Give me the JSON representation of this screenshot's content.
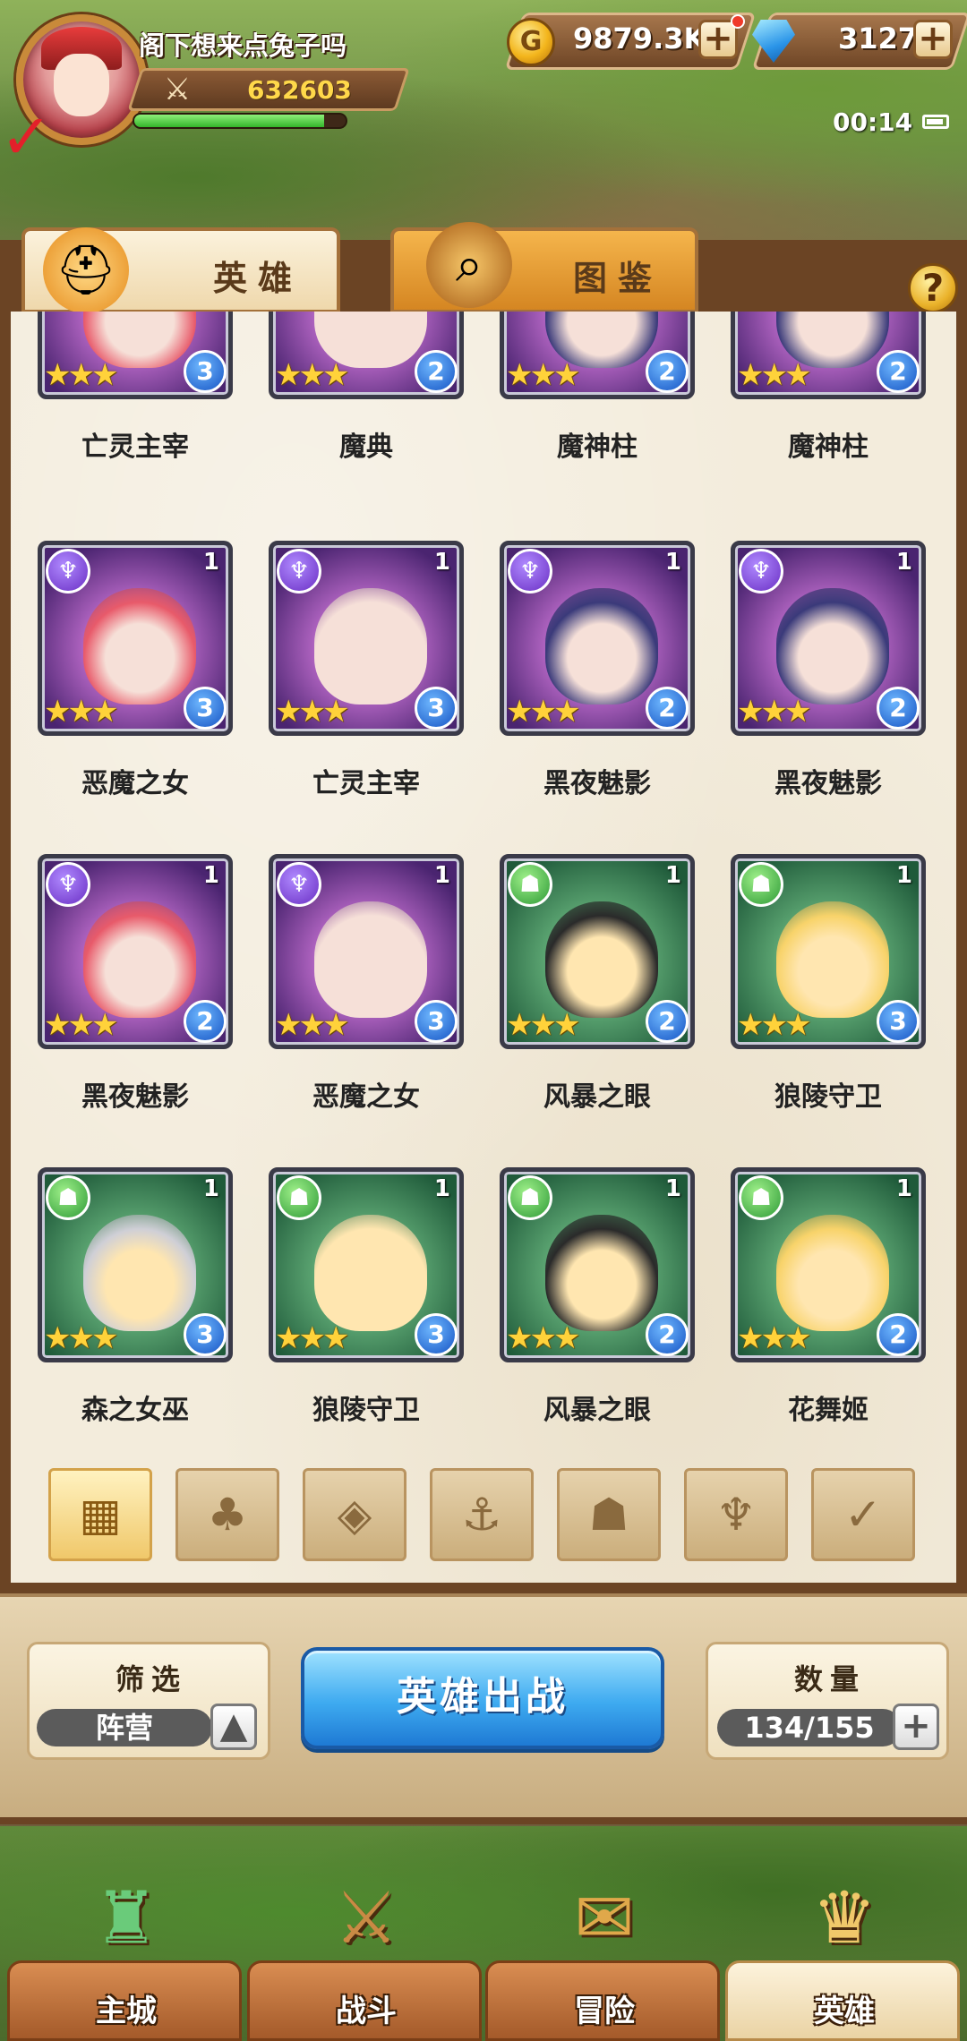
{
  "player": {
    "name": "阁下想来点兔子吗",
    "power": "632603",
    "exp_fraction": 0.9
  },
  "currency": {
    "gold": "9879.3K",
    "gems": "3127"
  },
  "status": {
    "time": "00:14"
  },
  "tabs": [
    {
      "label": "英雄",
      "icon": "knight-helmet-icon"
    },
    {
      "label": "图鉴",
      "icon": "magnifier-book-icon"
    }
  ],
  "help_label": "?",
  "heroes": [
    {
      "name": "亡灵主宰",
      "faction": "dark",
      "level": "",
      "grade": "3",
      "stars": 3,
      "theme": "purple"
    },
    {
      "name": "魔典",
      "faction": "dark",
      "level": "",
      "grade": "2",
      "stars": 3,
      "theme": "purple"
    },
    {
      "name": "魔神柱",
      "faction": "dark",
      "level": "",
      "grade": "2",
      "stars": 3,
      "theme": "purple"
    },
    {
      "name": "魔神柱",
      "faction": "dark",
      "level": "",
      "grade": "2",
      "stars": 3,
      "theme": "purple"
    },
    {
      "name": "恶魔之女",
      "faction": "dark",
      "level": "1",
      "grade": "3",
      "stars": 3,
      "theme": "purple"
    },
    {
      "name": "亡灵主宰",
      "faction": "dark",
      "level": "1",
      "grade": "3",
      "stars": 3,
      "theme": "purple"
    },
    {
      "name": "黑夜魅影",
      "faction": "dark",
      "level": "1",
      "grade": "2",
      "stars": 3,
      "theme": "purple"
    },
    {
      "name": "黑夜魅影",
      "faction": "dark",
      "level": "1",
      "grade": "2",
      "stars": 3,
      "theme": "purple"
    },
    {
      "name": "黑夜魅影",
      "faction": "dark",
      "level": "1",
      "grade": "2",
      "stars": 3,
      "theme": "purple"
    },
    {
      "name": "恶魔之女",
      "faction": "dark",
      "level": "1",
      "grade": "3",
      "stars": 3,
      "theme": "purple"
    },
    {
      "name": "风暴之眼",
      "faction": "nature",
      "level": "1",
      "grade": "2",
      "stars": 3,
      "theme": "green"
    },
    {
      "name": "狼陵守卫",
      "faction": "nature",
      "level": "1",
      "grade": "3",
      "stars": 3,
      "theme": "green"
    },
    {
      "name": "森之女巫",
      "faction": "nature",
      "level": "1",
      "grade": "3",
      "stars": 3,
      "theme": "green"
    },
    {
      "name": "狼陵守卫",
      "faction": "nature",
      "level": "1",
      "grade": "3",
      "stars": 3,
      "theme": "green"
    },
    {
      "name": "风暴之眼",
      "faction": "nature",
      "level": "1",
      "grade": "2",
      "stars": 3,
      "theme": "green"
    },
    {
      "name": "花舞姬",
      "faction": "nature",
      "level": "1",
      "grade": "2",
      "stars": 3,
      "theme": "green"
    }
  ],
  "faction_filters": [
    {
      "name": "all-grid-icon",
      "glyph": "▦",
      "active": true
    },
    {
      "name": "light-leaf-icon",
      "glyph": "♣",
      "active": false
    },
    {
      "name": "diamond-icon",
      "glyph": "◈",
      "active": false
    },
    {
      "name": "anchor-icon",
      "glyph": "⚓",
      "active": false
    },
    {
      "name": "beast-head-icon",
      "glyph": "☗",
      "active": false
    },
    {
      "name": "demon-horns-icon",
      "glyph": "♆",
      "active": false
    },
    {
      "name": "wings-icon",
      "glyph": "✓",
      "active": false
    }
  ],
  "controls": {
    "filter_title": "筛选",
    "filter_value": "阵营",
    "deploy_label": "英雄出战",
    "count_title": "数量",
    "count_value": "134/155"
  },
  "nav": [
    {
      "label": "主城",
      "icon": "castle-icon",
      "active": false
    },
    {
      "label": "战斗",
      "icon": "crossed-swords-icon",
      "active": false
    },
    {
      "label": "冒险",
      "icon": "scroll-map-icon",
      "active": false
    },
    {
      "label": "英雄",
      "icon": "hero-crest-icon",
      "active": true
    }
  ],
  "colors": {
    "grade_blue": "#1654c4",
    "dark_faction": "#6a2fc4",
    "nature_faction": "#2e9a36",
    "deploy_button": "#3eaaf0"
  }
}
